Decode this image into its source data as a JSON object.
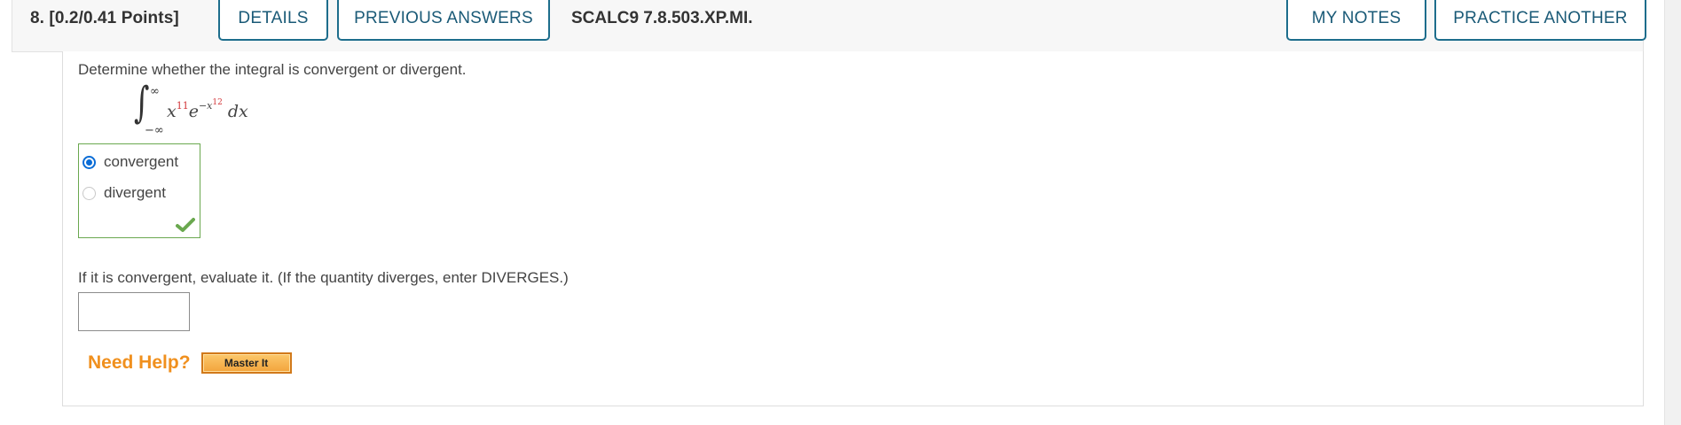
{
  "header": {
    "question_title": "8.  [0.2/0.41 Points]",
    "details_label": "DETAILS",
    "previous_answers_label": "PREVIOUS ANSWERS",
    "reference_code": "SCALC9 7.8.503.XP.MI.",
    "my_notes_label": "MY NOTES",
    "practice_another_label": "PRACTICE ANOTHER"
  },
  "question": {
    "prompt": "Determine whether the integral is convergent or divergent.",
    "integral": {
      "upper_limit": "∞",
      "lower_limit": "−∞",
      "base": "x",
      "exponent": "11",
      "e_char": "e",
      "e_exp_prefix": "−x",
      "e_exp_power": "12",
      "differential": "dx"
    },
    "choices": [
      {
        "label": "convergent",
        "selected": true
      },
      {
        "label": "divergent",
        "selected": false
      }
    ],
    "result": "correct",
    "evaluate_prompt": "If it is convergent, evaluate it. (If the quantity diverges, enter DIVERGES.)",
    "answer_value": ""
  },
  "help": {
    "need_help_label": "Need Help?",
    "master_it_label": "Master It"
  },
  "colors": {
    "button_border": "#1d6d8c",
    "button_text": "#1a5a77",
    "correct_green": "#6aa84f",
    "radio_blue": "#0a6cd6",
    "highlight_red": "#d2373b",
    "need_help_orange": "#f0901e"
  }
}
